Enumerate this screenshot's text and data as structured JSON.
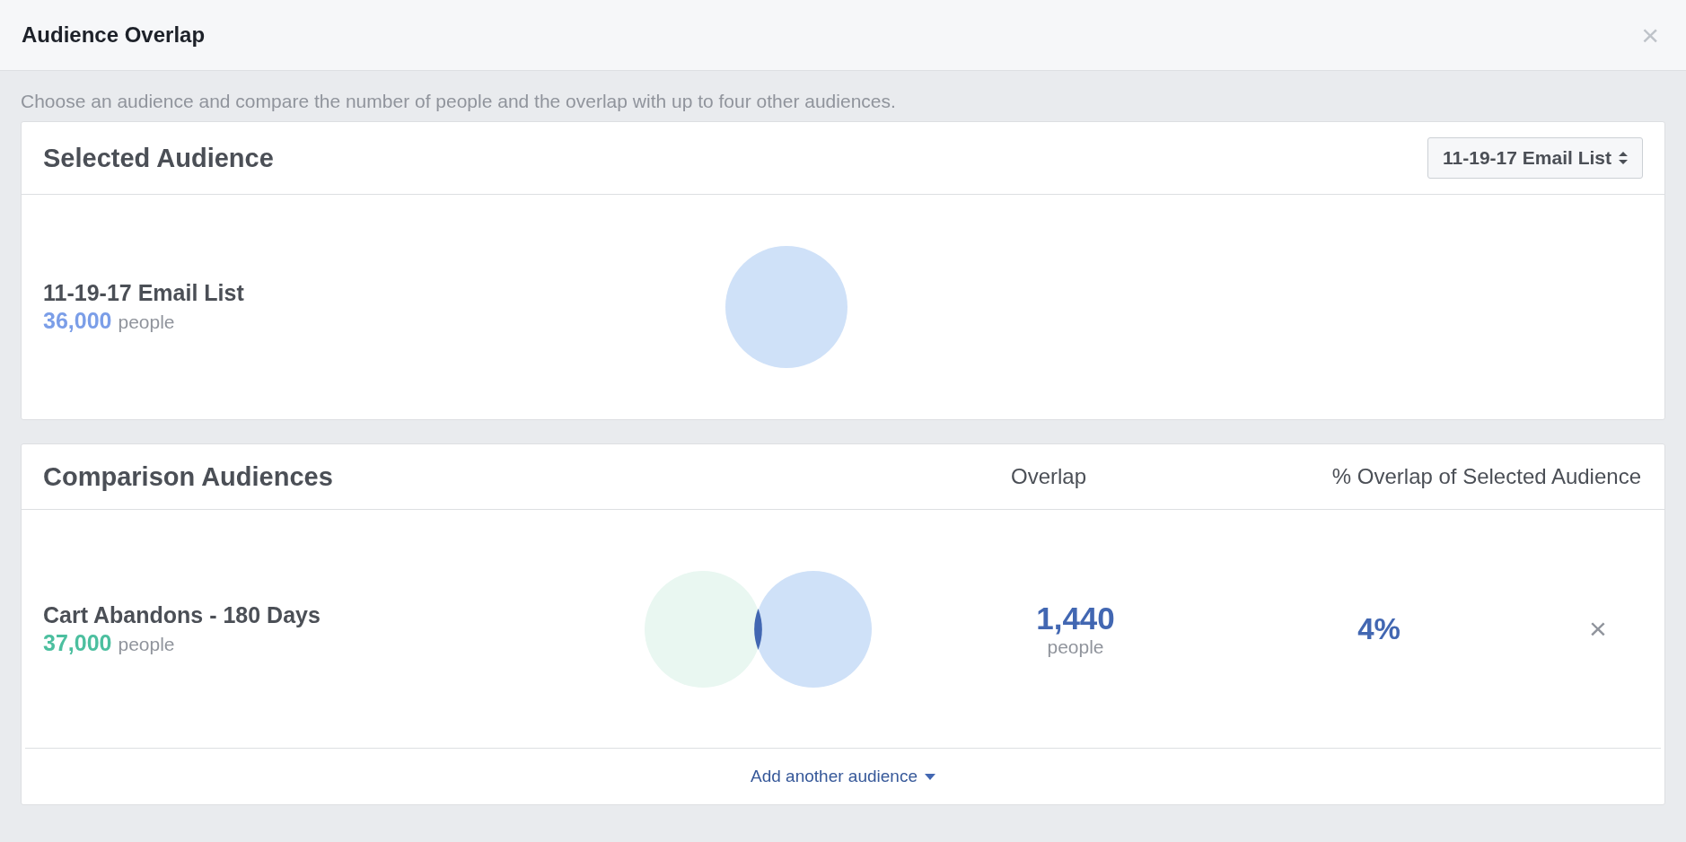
{
  "window": {
    "title": "Audience Overlap",
    "close": "×"
  },
  "description": "Choose an audience and compare the number of people and the overlap with up to four other audiences.",
  "selected_audience": {
    "heading": "Selected Audience",
    "dropdown": "11-19-17 Email List",
    "name": "11-19-17 Email List",
    "count": "36,000",
    "unit": "people",
    "color": "#7b9ee8"
  },
  "comparison": {
    "heading": "Comparison Audiences",
    "columns": [
      "Overlap",
      "% Overlap of Selected Audience"
    ],
    "rows": [
      {
        "name": "Cart Abandons - 180 Days",
        "count": "37,000",
        "unit": "people",
        "color": "#4cbf9f",
        "overlap": "1,440",
        "overlap_unit": "people",
        "percent": "4%",
        "remove": "×"
      }
    ],
    "add_link": "Add another audience"
  }
}
